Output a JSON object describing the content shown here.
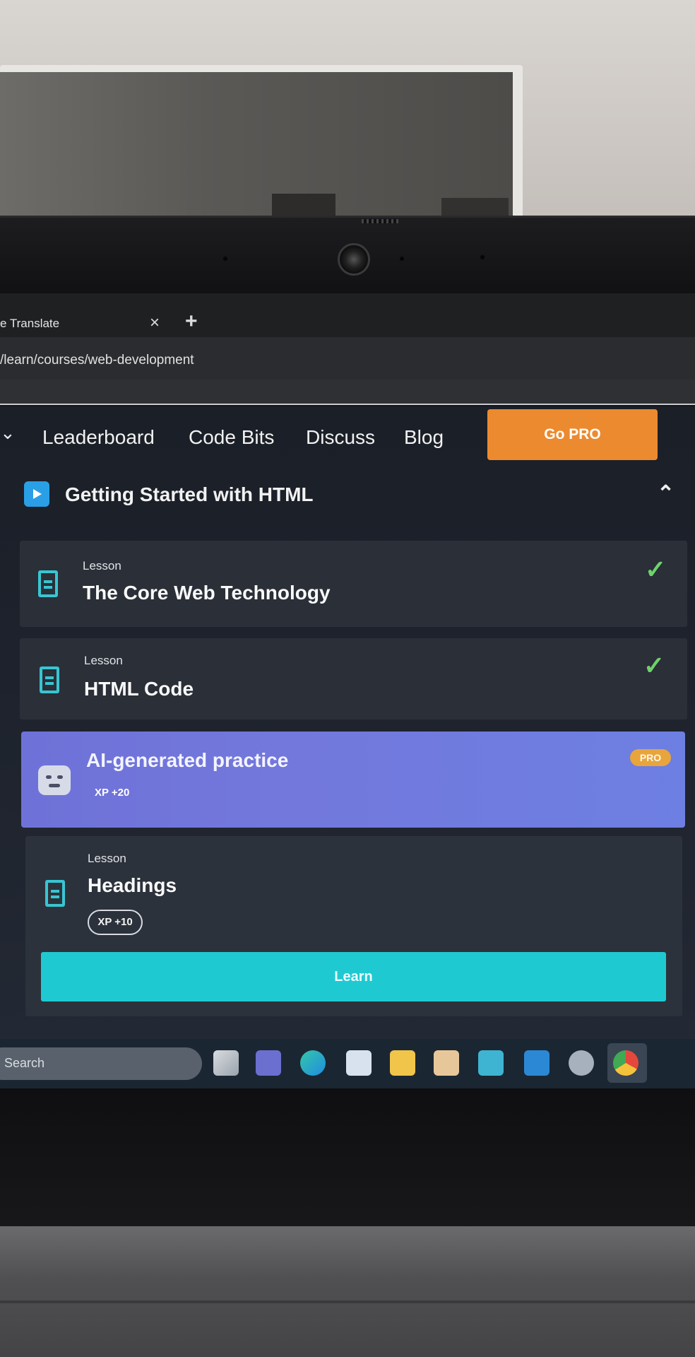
{
  "browser": {
    "tab_title": "e Translate",
    "tab_close": "×",
    "new_tab": "+",
    "url": "/learn/courses/web-development"
  },
  "nav": {
    "items": [
      "Leaderboard",
      "Code Bits",
      "Discuss",
      "Blog"
    ],
    "go_pro": "Go PRO"
  },
  "section": {
    "title": "Getting Started with HTML"
  },
  "lessons": [
    {
      "kicker": "Lesson",
      "title": "The Core Web Technology",
      "completed": true
    },
    {
      "kicker": "Lesson",
      "title": "HTML Code",
      "completed": true
    }
  ],
  "ai_practice": {
    "title": "AI-generated practice",
    "xp": "XP +20",
    "badge": "PRO"
  },
  "current_lesson": {
    "kicker": "Lesson",
    "title": "Headings",
    "xp": "XP +10",
    "button": "Learn"
  },
  "taskbar": {
    "search_placeholder": "Search"
  },
  "colors": {
    "go_pro": "#ec8a2f",
    "check": "#6fd26a",
    "accent_cyan": "#1fc9d2",
    "ai_card": "#7378dc",
    "pro_badge": "#e7a53c"
  }
}
